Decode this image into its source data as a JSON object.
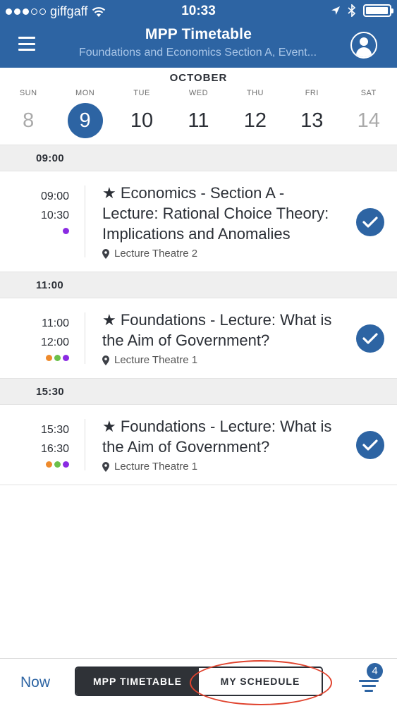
{
  "status_bar": {
    "carrier": "giffgaff",
    "time": "10:33",
    "signal_bars_filled": 3,
    "signal_bars_total": 5,
    "battery_level": 0.9
  },
  "header": {
    "title": "MPP Timetable",
    "subtitle": "Foundations and Economics Section A, Event..."
  },
  "calendar": {
    "month": "OCTOBER",
    "days": [
      {
        "name": "SUN",
        "num": "8",
        "weekend": true
      },
      {
        "name": "MON",
        "num": "9",
        "selected": true
      },
      {
        "name": "TUE",
        "num": "10"
      },
      {
        "name": "WED",
        "num": "11"
      },
      {
        "name": "THU",
        "num": "12"
      },
      {
        "name": "FRI",
        "num": "13"
      },
      {
        "name": "SAT",
        "num": "14",
        "weekend": true
      }
    ]
  },
  "schedule": [
    {
      "group": "09:00",
      "events": [
        {
          "start": "09:00",
          "end": "10:30",
          "title": "★ Economics - Section A - Lecture: Rational Choice Theory: Implications and Anomalies",
          "location": "Lecture Theatre 2",
          "tags": [
            "#8a2be2"
          ],
          "checked": true
        }
      ]
    },
    {
      "group": "11:00",
      "events": [
        {
          "start": "11:00",
          "end": "12:00",
          "title": "★ Foundations - Lecture: What is the Aim of Government?",
          "location": "Lecture Theatre 1",
          "tags": [
            "#ee8a2c",
            "#6cc04a",
            "#8a2be2"
          ],
          "checked": true
        }
      ]
    },
    {
      "group": "15:30",
      "events": [
        {
          "start": "15:30",
          "end": "16:30",
          "title": "★ Foundations - Lecture: What is the Aim of Government?",
          "location": "Lecture Theatre 1",
          "tags": [
            "#ee8a2c",
            "#6cc04a",
            "#8a2be2"
          ],
          "checked": true
        }
      ]
    }
  ],
  "bottom_bar": {
    "now_label": "Now",
    "tab_timetable": "MPP TIMETABLE",
    "tab_schedule": "MY SCHEDULE",
    "filter_count": "4"
  },
  "colors": {
    "brand": "#2d64a3",
    "highlight": "#e0432e"
  },
  "icons": [
    "menu-icon",
    "profile-icon",
    "location-pin-icon",
    "checkmark-icon",
    "filter-icon",
    "wifi-icon",
    "location-arrow-icon",
    "bluetooth-icon",
    "battery-icon"
  ]
}
